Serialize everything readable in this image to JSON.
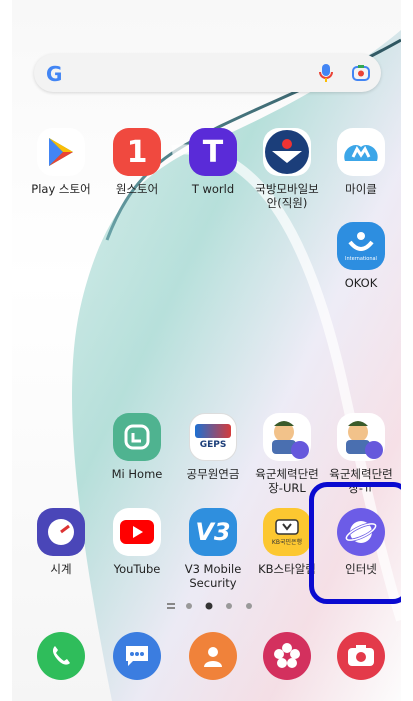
{
  "search_bar": {
    "logo": "G",
    "icons": [
      "mic-icon",
      "lens-icon"
    ]
  },
  "apps_row1": [
    {
      "label": "Play 스토어",
      "icon": "play-store-icon"
    },
    {
      "label": "원스토어",
      "icon": "onestore-icon"
    },
    {
      "label": "T world",
      "icon": "tworld-icon"
    },
    {
      "label": "국방모바일보\n안(직원)",
      "icon": "defense-mobile-security-icon"
    },
    {
      "label": "마이클",
      "icon": "michael-icon"
    }
  ],
  "apps_row2": [
    {
      "label": "OKOK",
      "icon": "okok-icon"
    }
  ],
  "apps_row3": [
    {
      "label": "Mi Home",
      "icon": "mi-home-icon"
    },
    {
      "label": "공무원연금",
      "icon": "geps-icon"
    },
    {
      "label": "육군체력단련\n장-URL",
      "icon": "army-fitness-url-icon"
    },
    {
      "label": "육군체력단련\n장-ㅠ",
      "icon": "army-fitness-icon"
    }
  ],
  "apps_row4": [
    {
      "label": "시계",
      "icon": "clock-icon"
    },
    {
      "label": "YouTube",
      "icon": "youtube-icon"
    },
    {
      "label": "V3 Mobile\nSecurity",
      "icon": "v3-security-icon"
    },
    {
      "label": "KB스타알림",
      "icon": "kb-star-alarm-icon"
    },
    {
      "label": "인터넷",
      "icon": "internet-icon"
    }
  ],
  "dock": [
    "phone-icon",
    "messages-icon",
    "contacts-icon",
    "gallery-icon",
    "camera-icon"
  ],
  "pager": {
    "pages": 4,
    "current": 2
  },
  "text_misc": {
    "geps": "GEPS",
    "okok_small": "International",
    "kb_small": "KB국민은행"
  }
}
